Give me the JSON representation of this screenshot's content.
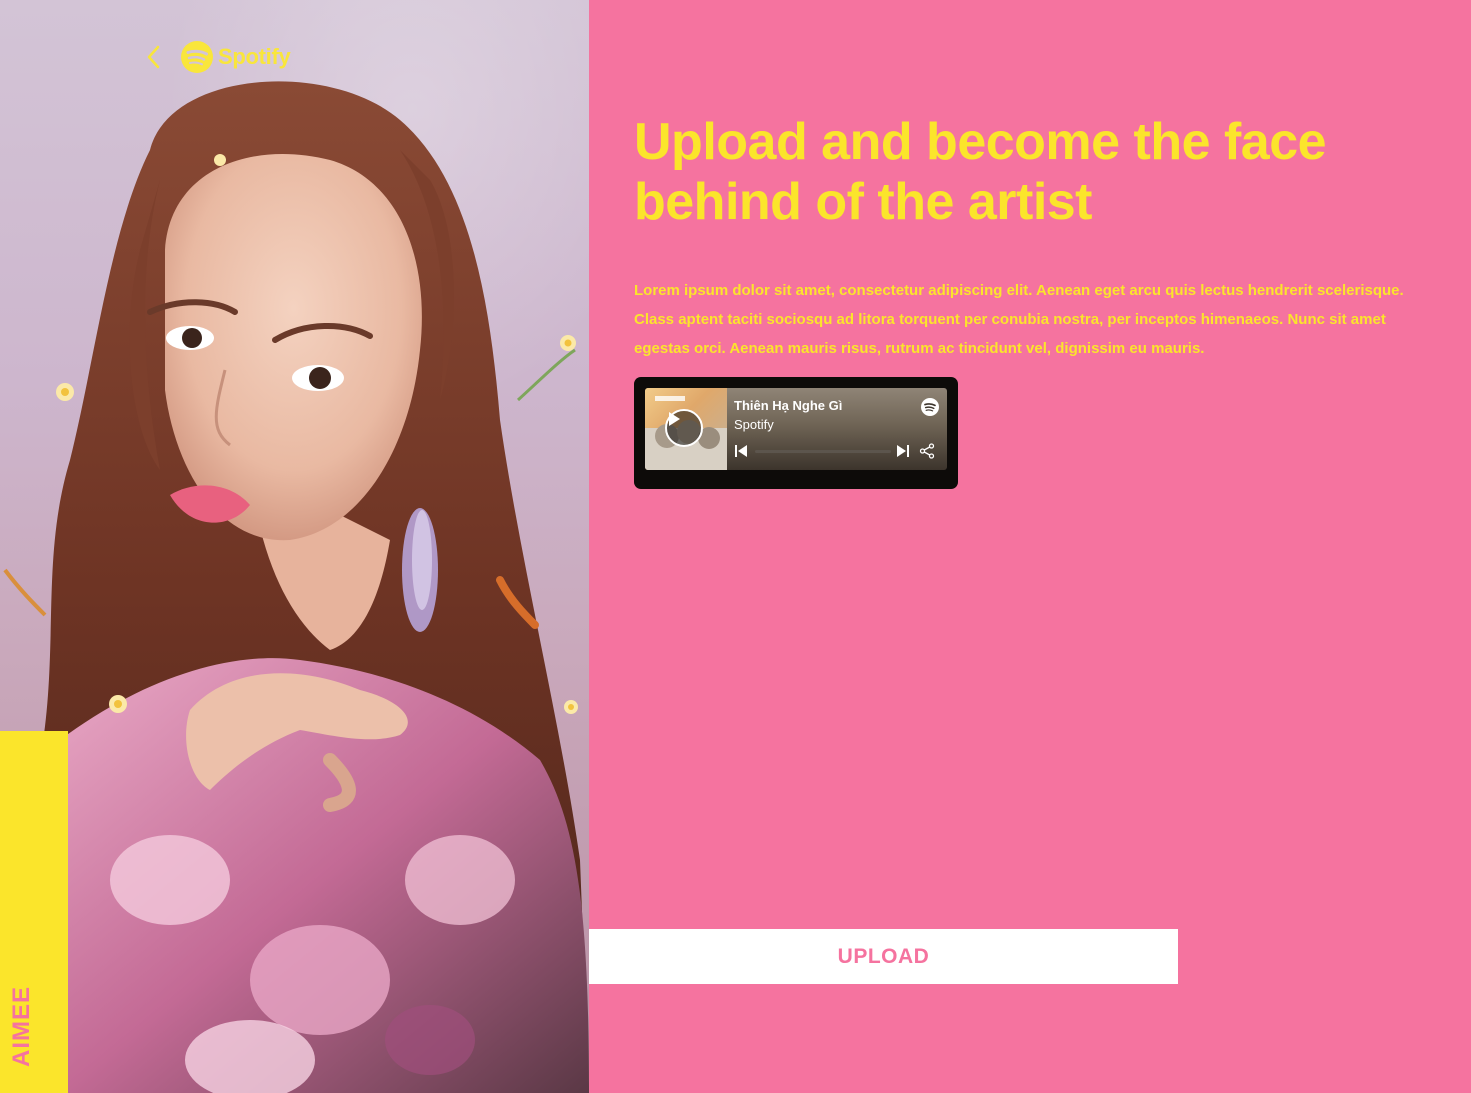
{
  "brand": {
    "name": "Spotify",
    "icons": {
      "back": "chevron-left-icon",
      "logo": "spotify-logo-icon"
    }
  },
  "artist": {
    "name": "AIMEE"
  },
  "hero": {
    "headline": "Upload and become the face behind of the artist",
    "body": "Lorem ipsum dolor sit amet, consectetur adipiscing elit. Aenean eget arcu quis lectus hendrerit scelerisque. Class aptent taciti sociosqu ad litora torquent per conubia nostra, per inceptos himenaeos. Nunc sit amet egestas orci. Aenean mauris risus, rutrum ac tincidunt vel, dignissim eu mauris."
  },
  "player": {
    "track_title": "Thiên Hạ Nghe Gì",
    "artist": "Spotify",
    "progress": 0.0,
    "icons": [
      "play-icon",
      "skip-back-icon",
      "skip-forward-icon",
      "share-icon",
      "spotify-icon"
    ]
  },
  "actions": {
    "upload_label": "UPLOAD"
  },
  "colors": {
    "background": "#f5739f",
    "accent_yellow": "#fbe52b",
    "button_bg": "#ffffff",
    "button_text": "#f5739f",
    "player_bg": "#0d0b09"
  }
}
